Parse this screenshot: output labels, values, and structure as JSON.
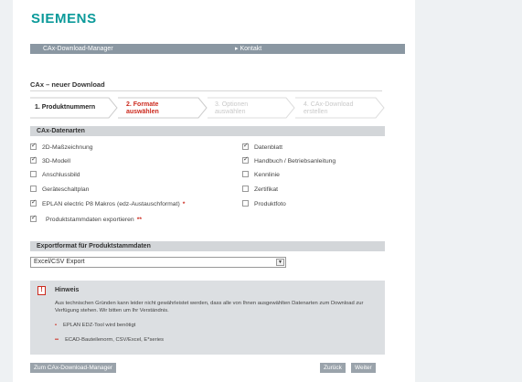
{
  "brand": {
    "logo": "SIEMENS"
  },
  "nav": {
    "item1": "CAx-Download-Manager",
    "item2": "▸ Kontakt"
  },
  "page": {
    "title": "CAx – neuer Download"
  },
  "steps": [
    {
      "label1": "1. Produktnummern",
      "label2": ""
    },
    {
      "label1": "2. Formate",
      "label2": "auswählen"
    },
    {
      "label1": "3. Optionen",
      "label2": "auswählen"
    },
    {
      "label1": "4. CAx-Download",
      "label2": "erstellen"
    }
  ],
  "cax": {
    "heading": "CAx-Datenarten",
    "left": [
      {
        "label": "2D-Maßzeichnung",
        "checked": true
      },
      {
        "label": "3D-Modell",
        "checked": true
      },
      {
        "label": "Anschlussbild",
        "checked": false
      },
      {
        "label": "Geräteschaltplan",
        "checked": false
      },
      {
        "label": "EPLAN electric P8 Makros (edz-Austauschformat)",
        "checked": true,
        "star": "*"
      },
      {
        "label": "Produktstammdaten exportieren",
        "checked": true,
        "star": "**"
      }
    ],
    "right": [
      {
        "label": "Datenblatt",
        "checked": true
      },
      {
        "label": "Handbuch / Betriebsanleitung",
        "checked": true
      },
      {
        "label": "Kennlinie",
        "checked": false
      },
      {
        "label": "Zertifikat",
        "checked": false
      },
      {
        "label": "Produktfoto",
        "checked": false
      }
    ]
  },
  "export": {
    "heading": "Exportformat für Produktstammdaten",
    "selected": "Excel/CSV Export"
  },
  "hint": {
    "icon": "!",
    "title": "Hinweis",
    "text": "Aus technischen Gründen kann leider nicht gewährleistet werden, dass alle von Ihnen ausgewählten Datenarten zum Download zur Verfügung stehen. Wir bitten um Ihr Verständnis.",
    "note1_marker": "•",
    "note1": "EPLAN EDZ-Tool wird benötigt",
    "note2_marker": "••",
    "note2": "ECAD-Bauteilenorm, CSV/Excel, E*series"
  },
  "buttons": {
    "back_to_manager": "Zum CAx-Download-Manager",
    "back": "Zurück",
    "next": "Weiter"
  },
  "colors": {
    "brand": "#0b9a9a",
    "accent_red": "#cc2a1e",
    "nav_bg": "#8a97a2"
  }
}
